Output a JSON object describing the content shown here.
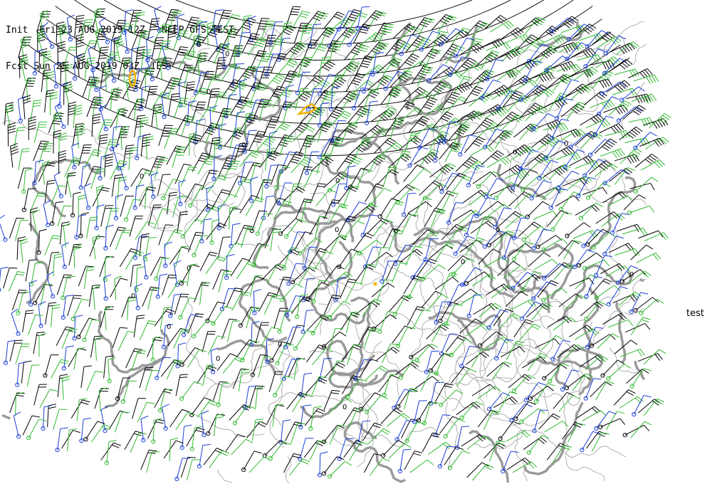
{
  "header": {
    "init_line": "Init  Fri 23 AUG 2019 12Z   NCEP GFS TEST",
    "fcst_line": "Fcst Sun 25 AUG 2019 03Z  TEST"
  },
  "side_label": "test",
  "map": {
    "projection": "polar stereographic sector (Europe / North Atlantic)",
    "layers": [
      "wind-barbs-upper-level",
      "wind-barbs-lower-level",
      "coastlines",
      "isobar-contours",
      "highlight-contours"
    ],
    "colors": {
      "coastline": "#b0b0b0",
      "contour": "#9a9a9a",
      "barb_black": "#000000",
      "barb_green": "#2fb82f",
      "barb_blue": "#1a3fd6",
      "highlight": "#f0b400"
    },
    "contour_labels": [
      "0"
    ]
  }
}
